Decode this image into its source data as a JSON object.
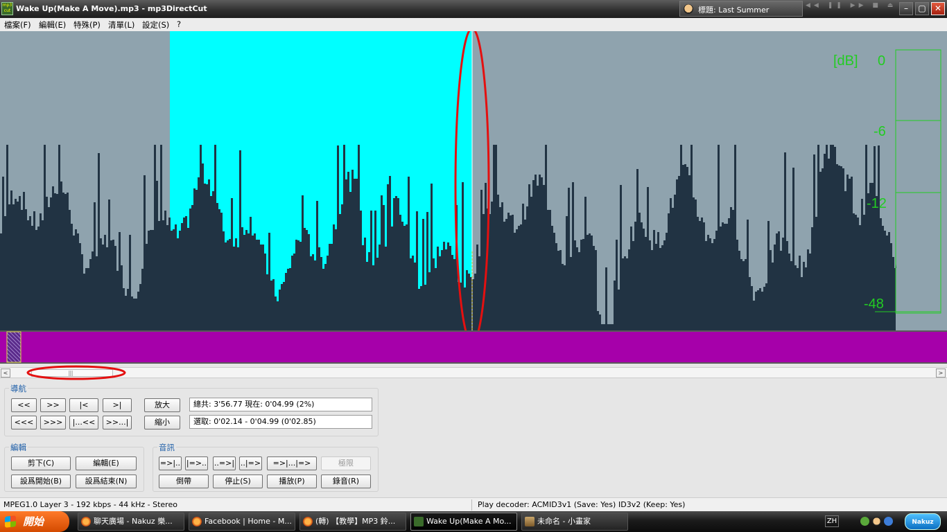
{
  "window": {
    "title": "Wake Up(Make A Move).mp3 - mp3DirectCut",
    "app_icon": "mp3directcut-icon",
    "now_playing": "標題: Last Summer",
    "player_controls": [
      "rewind",
      "pause",
      "forward",
      "stop",
      "eject"
    ],
    "minimize": "–",
    "maximize": "▢",
    "close": "✕"
  },
  "menu": [
    "檔案(F)",
    "編輯(E)",
    "特殊(P)",
    "清單(L)",
    "設定(S)",
    "?"
  ],
  "waveform": {
    "selection_color": "#00ffff",
    "background_color": "#8fa3ae",
    "wave_color": "#213343",
    "meter_color": "#22cc22",
    "db_unit": "[dB]",
    "db_labels": [
      "0",
      "-6",
      "-12",
      "-48"
    ],
    "annotation_color": "#e41010"
  },
  "overview": {
    "track_color": "#a600aa",
    "position_fraction": 0.02
  },
  "scrollbar": {
    "left_arrow": "<",
    "right_arrow": ">",
    "grip": "||||"
  },
  "nav": {
    "legend": "導航",
    "row1": [
      "<<",
      ">>",
      "|<",
      ">|"
    ],
    "row2": [
      "<<<",
      ">>>",
      "|...<<",
      ">>...|"
    ],
    "zoom_in": "放大",
    "zoom_out": "縮小",
    "total_info": "總共: 3'56.77  現在: 0'04.99  (2%)",
    "selection_info": "選取: 0'02.14 - 0'04.99 (0'02.85)"
  },
  "edit": {
    "legend": "編輯",
    "cut": "剪下(C)",
    "edit": "編輯(E)",
    "set_begin": "設爲開始(B)",
    "set_end": "設爲結束(N)"
  },
  "audio": {
    "legend": "音訊",
    "row1": [
      "=>|..",
      "|=>..",
      "..=>|",
      "..|=>",
      "=>|...|=>"
    ],
    "limit": "極限",
    "rewind": "倒帶",
    "stop": "停止(S)",
    "play": "播放(P)",
    "record": "錄音(R)"
  },
  "status": {
    "format": "MPEG1.0 Layer 3 - 192 kbps - 44 kHz - Stereo",
    "decoder": "Play decoder: ACM",
    "id3v1": "ID3v1 (Save: Yes)",
    "id3v2": "ID3v2 (Keep: Yes)"
  },
  "taskbar": {
    "start": "開始",
    "tasks": [
      "聊天廣場 - Nakuz 樂...",
      "Facebook | Home - M...",
      "(轉) 【教學】MP3 鈴...",
      "Wake Up(Make A Mo...",
      "未命名 - 小畫家"
    ],
    "language": "ZH",
    "brand": "Nakuz"
  }
}
